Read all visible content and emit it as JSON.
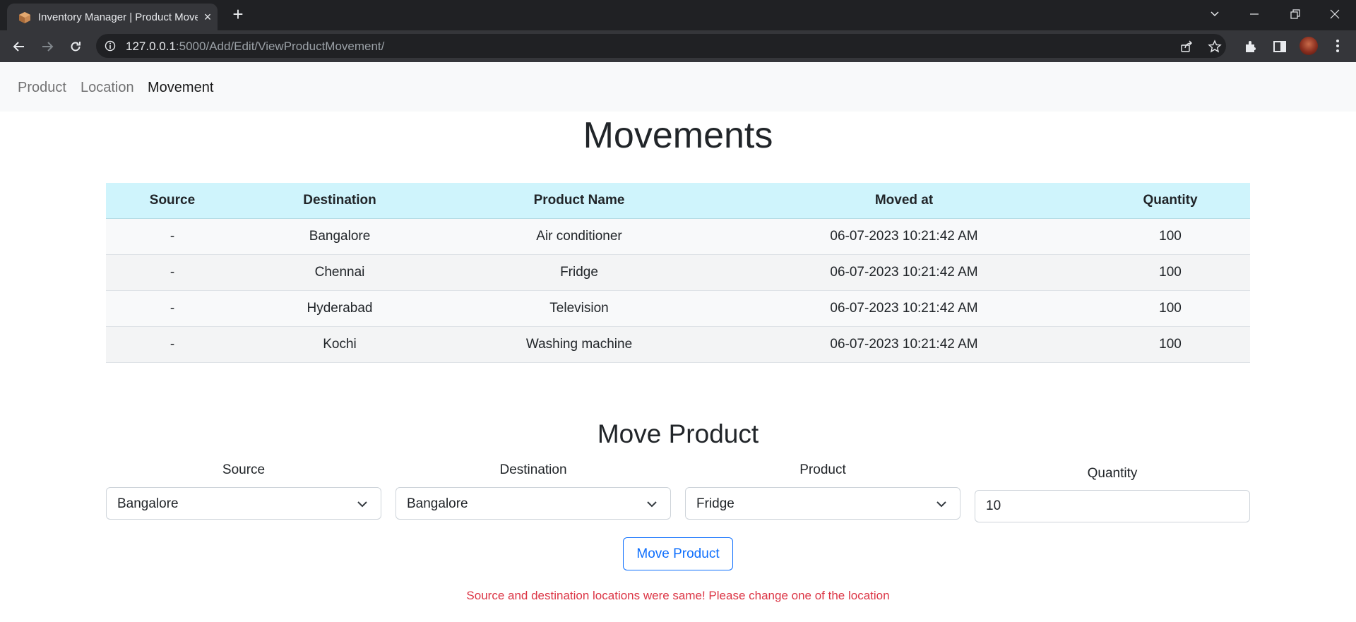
{
  "browser": {
    "tab_title": "Inventory Manager | Product Movement",
    "url_host": "127.0.0.1",
    "url_rest": ":5000/Add/Edit/ViewProductMovement/",
    "tab_close_glyph": "×",
    "new_tab_glyph": "+"
  },
  "navbar": {
    "links": [
      {
        "label": "Product",
        "active": false
      },
      {
        "label": "Location",
        "active": false
      },
      {
        "label": "Movement",
        "active": true
      }
    ]
  },
  "movements": {
    "title": "Movements",
    "columns": [
      "Source",
      "Destination",
      "Product Name",
      "Moved at",
      "Quantity"
    ],
    "rows": [
      {
        "source": "-",
        "destination": "Bangalore",
        "product": "Air conditioner",
        "moved_at": "06-07-2023 10:21:42 AM",
        "quantity": "100"
      },
      {
        "source": "-",
        "destination": "Chennai",
        "product": "Fridge",
        "moved_at": "06-07-2023 10:21:42 AM",
        "quantity": "100"
      },
      {
        "source": "-",
        "destination": "Hyderabad",
        "product": "Television",
        "moved_at": "06-07-2023 10:21:42 AM",
        "quantity": "100"
      },
      {
        "source": "-",
        "destination": "Kochi",
        "product": "Washing machine",
        "moved_at": "06-07-2023 10:21:42 AM",
        "quantity": "100"
      }
    ]
  },
  "move_form": {
    "title": "Move Product",
    "source_label": "Source",
    "source_value": "Bangalore",
    "destination_label": "Destination",
    "destination_value": "Bangalore",
    "product_label": "Product",
    "product_value": "Fridge",
    "quantity_label": "Quantity",
    "quantity_value": "10",
    "submit_label": "Move Product",
    "error": "Source and destination locations were same! Please change one of the location"
  },
  "colors": {
    "table_header_bg": "#cff4fc",
    "button_accent": "#0d6efd",
    "error_text": "#dc3545"
  },
  "icons": [
    "back-arrow-icon",
    "forward-arrow-icon",
    "reload-icon",
    "info-icon",
    "share-icon",
    "star-icon",
    "extensions-icon",
    "sidepanel-icon",
    "menu-icon",
    "chevron-down-icon"
  ]
}
